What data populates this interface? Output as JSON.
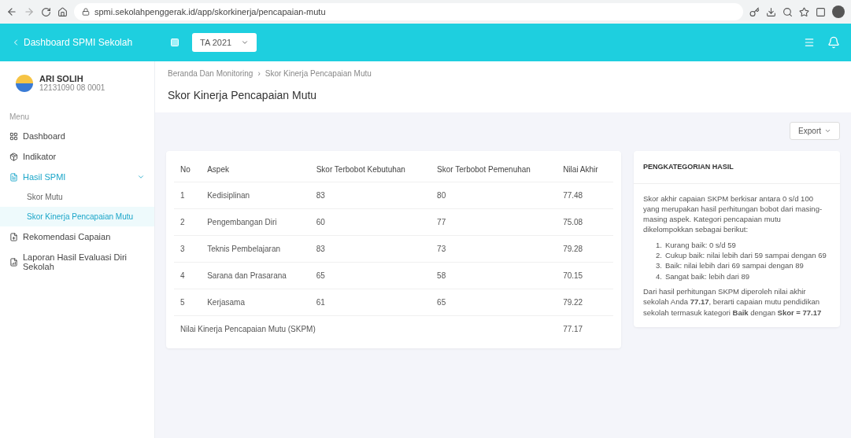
{
  "browser": {
    "url": "spmi.sekolahpenggerak.id/app/skorkinerja/pencapaian-mutu"
  },
  "header": {
    "title": "Dashboard SPMI Sekolah",
    "year_select": "TA 2021"
  },
  "user": {
    "name": "ARI SOLIH",
    "id": "12131090 08 0001"
  },
  "sidebar": {
    "section": "Menu",
    "items": [
      {
        "label": "Dashboard",
        "selected": false
      },
      {
        "label": "Indikator",
        "selected": false
      },
      {
        "label": "Hasil SPMI",
        "selected": true,
        "expanded": true,
        "children": [
          {
            "label": "Skor Mutu",
            "selected": false
          },
          {
            "label": "Skor Kinerja Pencapaian Mutu",
            "selected": true
          }
        ]
      },
      {
        "label": "Rekomendasi Capaian",
        "selected": false
      },
      {
        "label": "Laporan Hasil Evaluasi Diri Sekolah",
        "selected": false
      }
    ]
  },
  "breadcrumb": [
    "Beranda Dan Monitoring",
    "Skor Kinerja Pencapaian Mutu"
  ],
  "breadcrumb_separator": "›",
  "page_title": "Skor Kinerja Pencapaian Mutu",
  "export_button": "Export",
  "table": {
    "columns": [
      "No",
      "Aspek",
      "Skor Terbobot Kebutuhan",
      "Skor Terbobot Pemenuhan",
      "Nilai Akhir"
    ],
    "rows": [
      [
        "1",
        "Kedisiplinan",
        "83",
        "80",
        "77.48"
      ],
      [
        "2",
        "Pengembangan Diri",
        "60",
        "77",
        "75.08"
      ],
      [
        "3",
        "Teknis Pembelajaran",
        "83",
        "73",
        "79.28"
      ],
      [
        "4",
        "Sarana dan Prasarana",
        "65",
        "58",
        "70.15"
      ],
      [
        "5",
        "Kerjasama",
        "61",
        "65",
        "79.22"
      ]
    ],
    "footer": {
      "label": "Nilai Kinerja Pencapaian Mutu (SKPM)",
      "value": "77.17"
    }
  },
  "info": {
    "title": "PENGKATEGORIAN HASIL",
    "intro": "Skor akhir capaian SKPM berkisar antara 0 s/d 100 yang merupakan hasil perhitungan bobot dari masing-masing aspek. Kategori pencapaian mutu dikelompokkan sebagai berikut:",
    "list": [
      {
        "number": "1.",
        "text": "Kurang baik: 0 s/d 59"
      },
      {
        "number": "2.",
        "text": "Cukup baik: nilai lebih dari 59 sampai dengan 69"
      },
      {
        "number": "3.",
        "text": "Baik: nilai lebih dari 69 sampai dengan 89"
      },
      {
        "number": "4.",
        "text": "Sangat baik: lebih dari 89"
      }
    ],
    "summary": "Dari hasil perhitungan SKPM diperoleh nilai akhir sekolah Anda **77.17**, berarti capaian mutu pendidikan sekolah termasuk kategori **Baik** dengan **Skor = 77.17**"
  }
}
